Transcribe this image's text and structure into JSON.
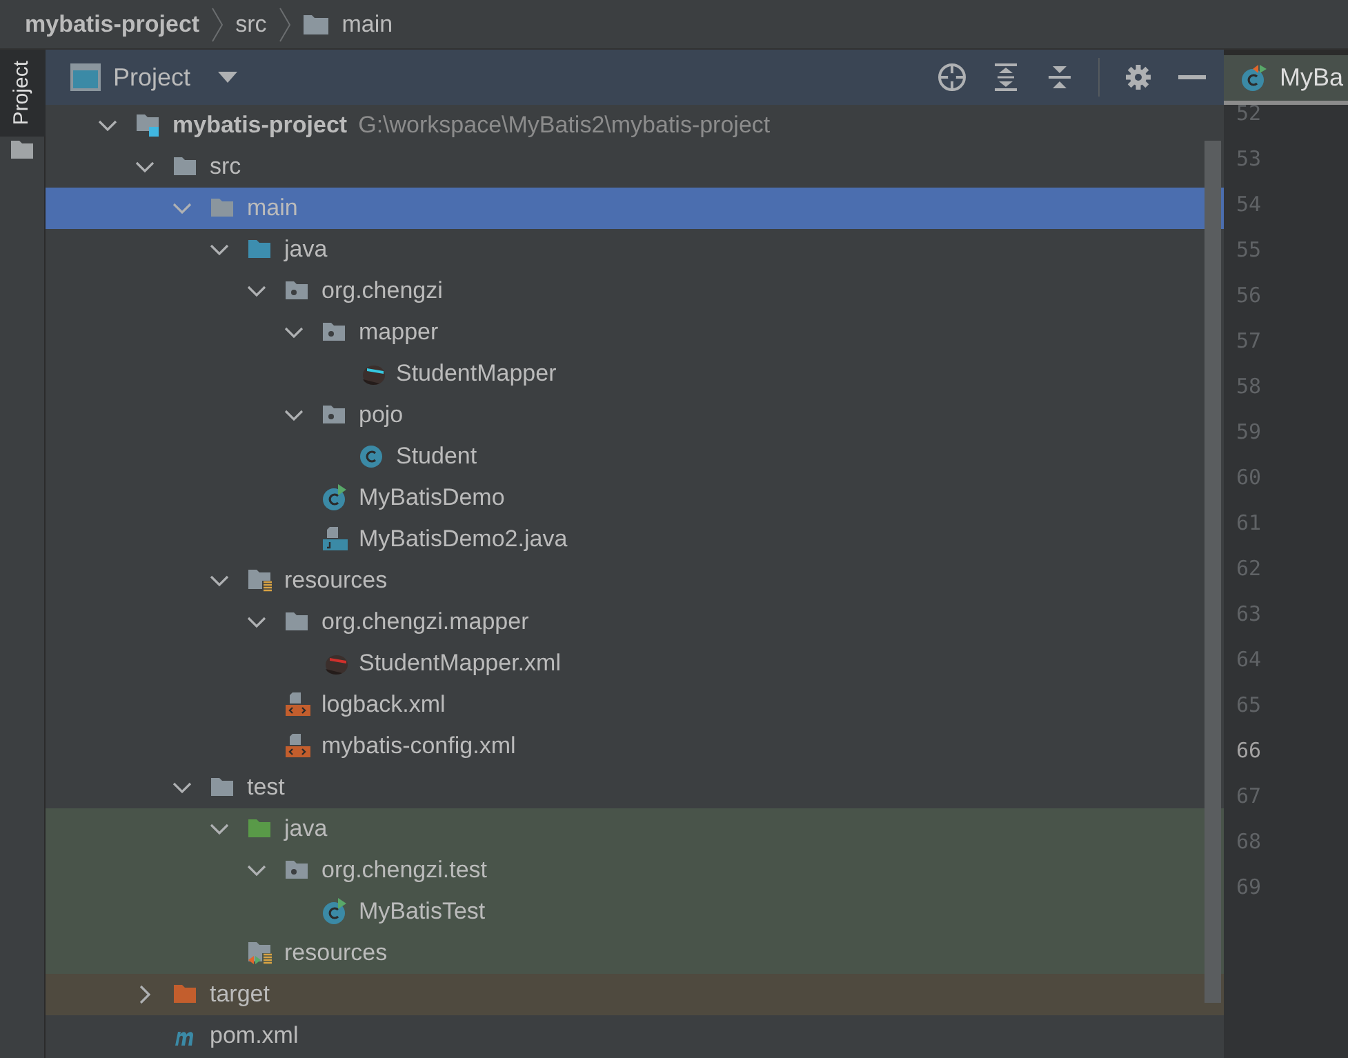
{
  "breadcrumb": [
    {
      "text": "mybatis-project",
      "kind": "project"
    },
    {
      "text": "src",
      "kind": "plain"
    },
    {
      "text": "main",
      "kind": "folder"
    }
  ],
  "side_tabs": [
    {
      "label": "Project",
      "selected": true
    }
  ],
  "panel": {
    "title": "Project"
  },
  "tree": [
    {
      "name": "mybatis-project",
      "kind": "module",
      "path": "G:\\workspace\\MyBatis2\\mybatis-project",
      "expanded": true,
      "selected": false,
      "children": [
        {
          "name": "src",
          "kind": "folder",
          "expanded": true,
          "selected": false,
          "children": [
            {
              "name": "main",
              "kind": "folder",
              "expanded": true,
              "selected": true,
              "children": [
                {
                  "name": "java",
                  "kind": "source",
                  "expanded": true,
                  "selected": false,
                  "children": [
                    {
                      "name": "org.chengzi",
                      "kind": "package",
                      "expanded": true,
                      "selected": false,
                      "children": [
                        {
                          "name": "mapper",
                          "kind": "package",
                          "expanded": true,
                          "selected": false,
                          "children": [
                            {
                              "name": "StudentMapper",
                              "kind": "mapper",
                              "selected": false
                            }
                          ]
                        },
                        {
                          "name": "pojo",
                          "kind": "package",
                          "expanded": true,
                          "selected": false,
                          "children": [
                            {
                              "name": "Student",
                              "kind": "class",
                              "selected": false
                            }
                          ]
                        },
                        {
                          "name": "MyBatisDemo",
                          "kind": "runnable",
                          "selected": false
                        },
                        {
                          "name": "MyBatisDemo2.java",
                          "kind": "javafile",
                          "selected": false
                        }
                      ]
                    }
                  ]
                },
                {
                  "name": "resources",
                  "kind": "resources",
                  "expanded": true,
                  "selected": false,
                  "children": [
                    {
                      "name": "org.chengzi.mapper",
                      "kind": "folder",
                      "expanded": true,
                      "selected": false,
                      "children": [
                        {
                          "name": "StudentMapper.xml",
                          "kind": "mapperxml",
                          "selected": false
                        }
                      ]
                    },
                    {
                      "name": "logback.xml",
                      "kind": "xml",
                      "selected": false
                    },
                    {
                      "name": "mybatis-config.xml",
                      "kind": "xml",
                      "selected": false
                    }
                  ]
                }
              ]
            },
            {
              "name": "test",
              "kind": "folder",
              "expanded": true,
              "selected": false,
              "children": [
                {
                  "name": "java",
                  "kind": "testsource",
                  "color": "#49544a",
                  "expanded": true,
                  "selected": false,
                  "children": [
                    {
                      "name": "org.chengzi.test",
                      "kind": "package",
                      "color": "#49544a",
                      "expanded": true,
                      "selected": false,
                      "children": [
                        {
                          "name": "MyBatisTest",
                          "kind": "runnable",
                          "color": "#49544a",
                          "selected": false
                        }
                      ]
                    }
                  ]
                },
                {
                  "name": "resources",
                  "kind": "testresources",
                  "color": "#49544a",
                  "selected": false
                }
              ]
            }
          ]
        },
        {
          "name": "target",
          "kind": "excluded",
          "color": "#4f4a3f",
          "expanded": false,
          "selected": false
        },
        {
          "name": "pom.xml",
          "kind": "maven",
          "selected": false
        }
      ]
    }
  ],
  "editor": {
    "tab": {
      "label": "MyBa"
    },
    "line_numbers": [
      {
        "text": "52",
        "current": false
      },
      {
        "text": "53",
        "current": false
      },
      {
        "text": "54",
        "current": false
      },
      {
        "text": "55",
        "current": false
      },
      {
        "text": "56",
        "current": false
      },
      {
        "text": "57",
        "current": false
      },
      {
        "text": "58",
        "current": false
      },
      {
        "text": "59",
        "current": false
      },
      {
        "text": "60",
        "current": false
      },
      {
        "text": "61",
        "current": false
      },
      {
        "text": "62",
        "current": false
      },
      {
        "text": "63",
        "current": false
      },
      {
        "text": "64",
        "current": false
      },
      {
        "text": "65",
        "current": false
      },
      {
        "text": "66",
        "current": true
      },
      {
        "text": "67",
        "current": false
      },
      {
        "text": "68",
        "current": false
      },
      {
        "text": "69",
        "current": false
      }
    ]
  }
}
